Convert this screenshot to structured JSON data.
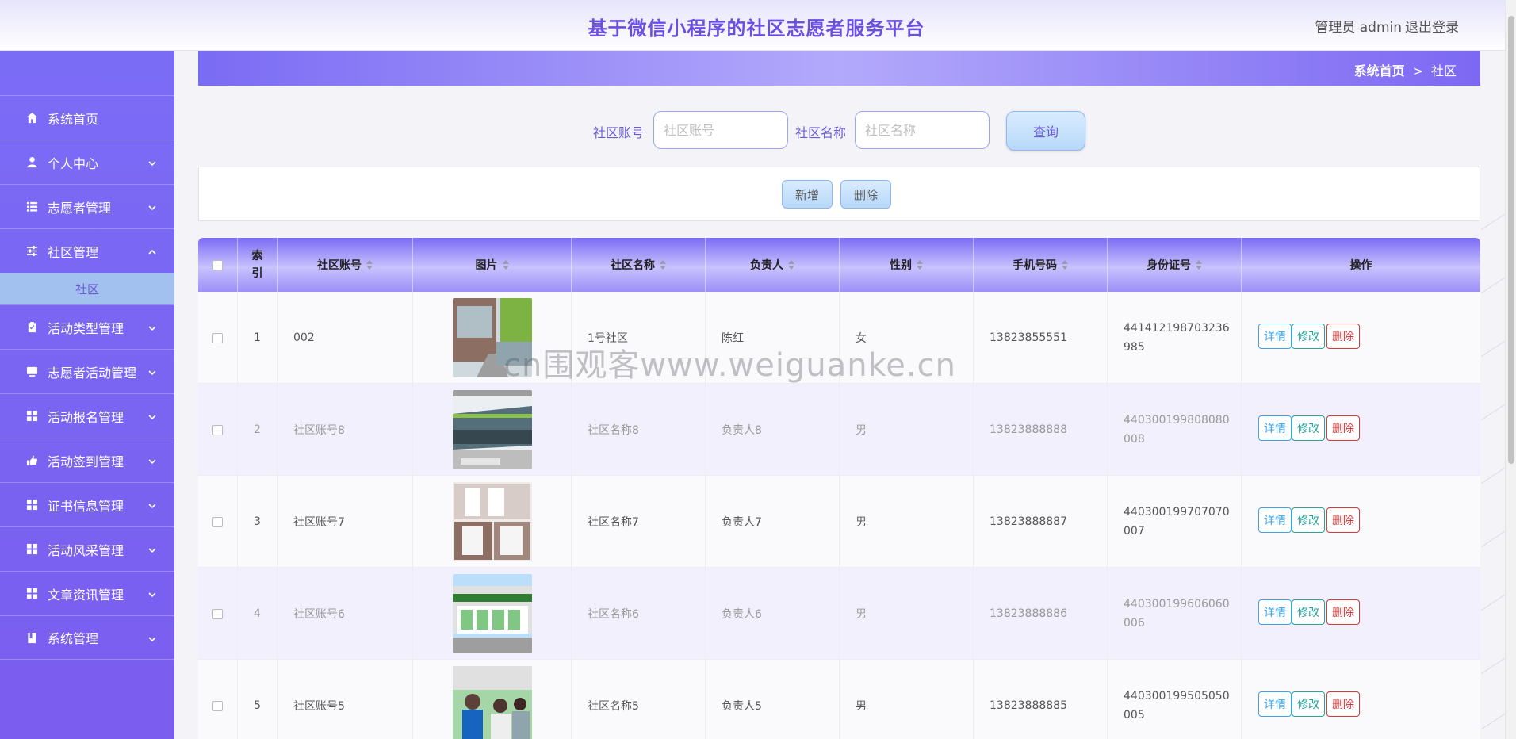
{
  "header": {
    "title": "基于微信小程序的社区志愿者服务平台",
    "user": "管理员 admin",
    "logout": "退出登录"
  },
  "sidebar": {
    "items": [
      {
        "label": "系统首页",
        "icon": "home-icon"
      },
      {
        "label": "个人中心",
        "icon": "user-icon"
      },
      {
        "label": "志愿者管理",
        "icon": "list-icon"
      },
      {
        "label": "社区管理",
        "icon": "sliders-icon",
        "expanded": true
      },
      {
        "label": "活动类型管理",
        "icon": "clipboard-icon"
      },
      {
        "label": "志愿者活动管理",
        "icon": "monitor-icon"
      },
      {
        "label": "活动报名管理",
        "icon": "grid-icon"
      },
      {
        "label": "活动签到管理",
        "icon": "hand-icon"
      },
      {
        "label": "证书信息管理",
        "icon": "grid-icon"
      },
      {
        "label": "活动风采管理",
        "icon": "grid-icon"
      },
      {
        "label": "文章资讯管理",
        "icon": "grid-icon"
      },
      {
        "label": "系统管理",
        "icon": "book-icon"
      }
    ],
    "submenu": {
      "label": "社区"
    }
  },
  "breadcrumb": {
    "home": "系统首页",
    "separator": ">",
    "current": "社区"
  },
  "search": {
    "account_label": "社区账号",
    "account_placeholder": "社区账号",
    "name_label": "社区名称",
    "name_placeholder": "社区名称",
    "query_button": "查询"
  },
  "actions": {
    "add": "新增",
    "delete": "删除"
  },
  "table": {
    "headers": {
      "index": "索引",
      "account": "社区账号",
      "image": "图片",
      "name": "社区名称",
      "leader": "负责人",
      "gender": "性别",
      "phone": "手机号码",
      "idcard": "身份证号",
      "ops": "操作"
    },
    "op_labels": {
      "detail": "详情",
      "edit": "修改",
      "del": "删除"
    },
    "rows": [
      {
        "index": "1",
        "account": "002",
        "name": "1号社区",
        "leader": "陈红",
        "gender": "女",
        "phone": "13823855551",
        "id1": "441412198703236",
        "id2": "985"
      },
      {
        "index": "2",
        "account": "社区账号8",
        "name": "社区名称8",
        "leader": "负责人8",
        "gender": "男",
        "phone": "13823888888",
        "id1": "440300199808080",
        "id2": "008"
      },
      {
        "index": "3",
        "account": "社区账号7",
        "name": "社区名称7",
        "leader": "负责人7",
        "gender": "男",
        "phone": "13823888887",
        "id1": "440300199707070",
        "id2": "007"
      },
      {
        "index": "4",
        "account": "社区账号6",
        "name": "社区名称6",
        "leader": "负责人6",
        "gender": "男",
        "phone": "13823888886",
        "id1": "440300199606060",
        "id2": "006"
      },
      {
        "index": "5",
        "account": "社区账号5",
        "name": "社区名称5",
        "leader": "负责人5",
        "gender": "男",
        "phone": "13823888885",
        "id1": "440300199505050",
        "id2": "005"
      }
    ]
  },
  "watermark": "cn围观客www.weiguanke.cn",
  "colors": {
    "accent": "#7b6cf6",
    "title": "#6b4fe0",
    "submenu": "#a3c1ef"
  }
}
